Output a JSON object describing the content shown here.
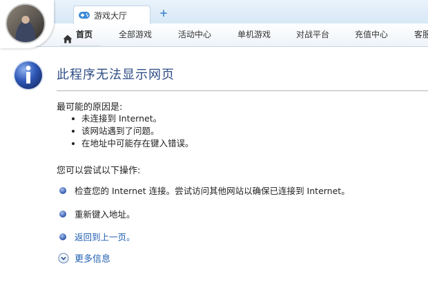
{
  "tabs": [
    {
      "label": "游戏大厅"
    }
  ],
  "tab_add_label": "+",
  "nav": {
    "items": [
      "首页",
      "全部游戏",
      "活动中心",
      "单机游戏",
      "对战平台",
      "充值中心",
      "客服"
    ]
  },
  "error": {
    "title": "此程序无法显示网页",
    "causes_title": "最可能的原因是:",
    "causes": [
      "未连接到 Internet。",
      "该网站遇到了问题。",
      "在地址中可能存在键入错误。"
    ],
    "actions_title": "您可以尝试以下操作:",
    "actions": [
      {
        "label": "检查您的 Internet 连接。尝试访问其他网站以确保已连接到 Internet。"
      },
      {
        "label": "重新键入地址。"
      },
      {
        "label": "返回到上一页。"
      }
    ],
    "more_info": "更多信息"
  },
  "colors": {
    "accent_link": "#1f5eb0",
    "title_blue": "#2d4c85",
    "tab_bar": "#d7e8f6"
  },
  "icons": {
    "avatar": "user-avatar",
    "tab": "gamepad-icon",
    "home": "home-icon",
    "info": "info-icon",
    "bullet": "blue-bullet-icon",
    "more": "chevron-down-circle-icon"
  }
}
